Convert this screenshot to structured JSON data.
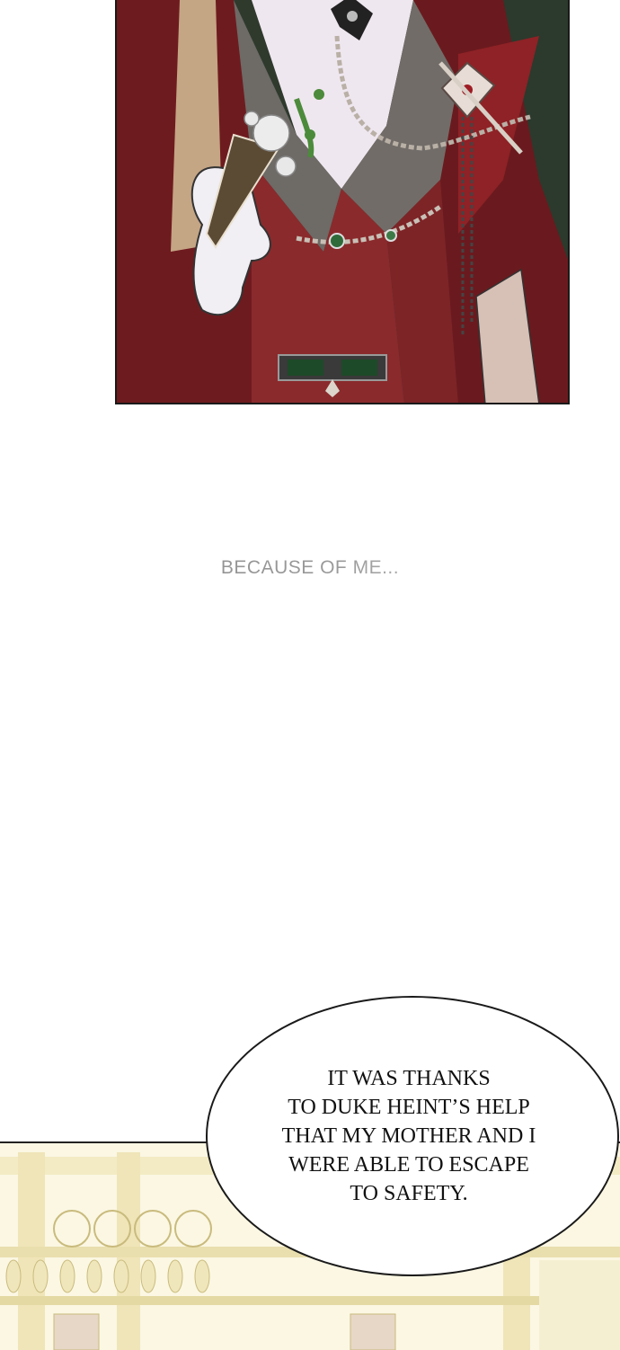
{
  "narration": "BECAUSE OF ME...",
  "speech_bubble": {
    "lines": [
      "IT WAS THANKS",
      "TO DUKE HEINT’S HELP",
      "THAT MY MOTHER AND I",
      "WERE ABLE TO ESCAPE",
      "TO SAFETY."
    ]
  },
  "colors": {
    "coat_red": "#7a1f22",
    "vest_red": "#8a2a2c",
    "lapel_gray": "#6e6a66",
    "glove_white": "#f1eef4",
    "gem_green": "#2f6b3a",
    "palace_cream": "#f3ebc4"
  },
  "icons": [
    "rose-corsage-icon",
    "brooch-icon",
    "belt-buckle-icon",
    "order-medal-icon"
  ]
}
